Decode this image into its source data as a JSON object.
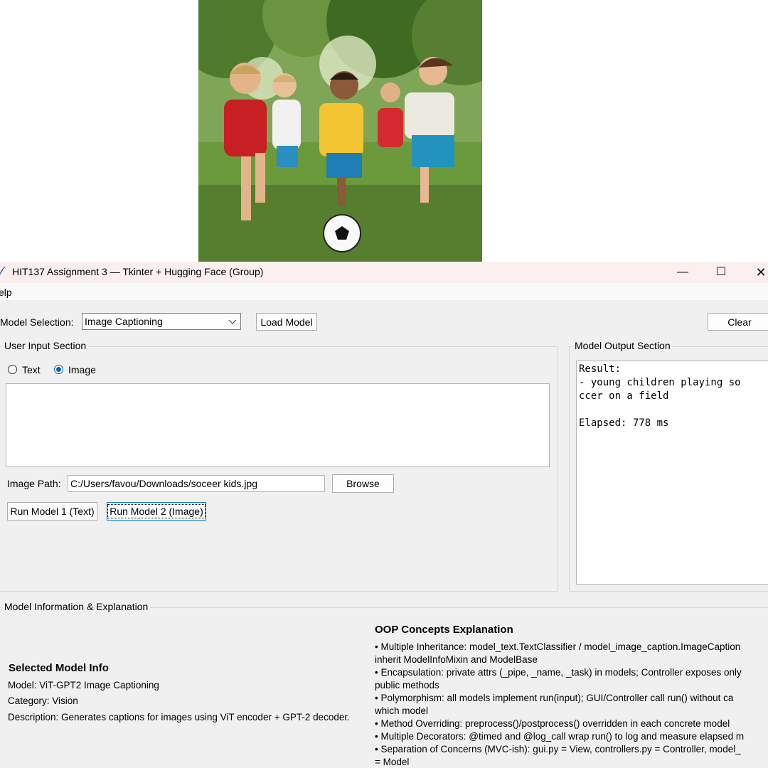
{
  "window": {
    "title": "HIT137 Assignment 3 — Tkinter + Hugging Face (Group)",
    "minimize_glyph": "—",
    "maximize_glyph": "☐",
    "close_glyph": "✕"
  },
  "menu": {
    "help": "elp"
  },
  "toolbar": {
    "model_selection_label": "Model Selection:",
    "model_selected": "Image Captioning",
    "load_model": "Load Model",
    "clear": "Clear"
  },
  "input_section": {
    "title": "User Input Section",
    "radio_text": "Text",
    "radio_image": "Image",
    "selected_mode": "Image",
    "text_value": "",
    "image_path_label": "Image Path:",
    "image_path": "C:/Users/favou/Downloads/soceer kids.jpg",
    "browse": "Browse",
    "run_model_1": "Run Model 1 (Text)",
    "run_model_2": "Run Model 2 (Image)"
  },
  "output_section": {
    "title": "Model Output Section",
    "text": "Result:\n- young children playing so\nccer on a field\n\nElapsed: 778 ms"
  },
  "info_section": {
    "title": "Model Information & Explanation",
    "selected_heading": "Selected Model Info",
    "model": "Model: ViT-GPT2 Image Captioning",
    "category": "Category: Vision",
    "description": "Description: Generates captions for images using ViT encoder + GPT-2 decoder.",
    "oop_heading": "OOP Concepts Explanation",
    "oop_lines": [
      "• Multiple Inheritance: model_text.TextClassifier / model_image_caption.ImageCaption",
      "inherit ModelInfoMixin and ModelBase",
      "• Encapsulation: private attrs (_pipe, _name, _task) in models; Controller exposes only",
      "public methods",
      "• Polymorphism: all models implement run(input); GUI/Controller call run() without ca",
      "which model",
      "• Method Overriding: preprocess()/postprocess() overridden in each concrete model",
      "• Multiple Decorators: @timed and @log_call wrap run() to log and measure elapsed m",
      "• Separation of Concerns (MVC-ish): gui.py = View, controllers.py = Controller, model_",
      "= Model"
    ]
  },
  "icons": {
    "app": "feather-icon",
    "combo_arrow": "chevron-down-icon"
  }
}
